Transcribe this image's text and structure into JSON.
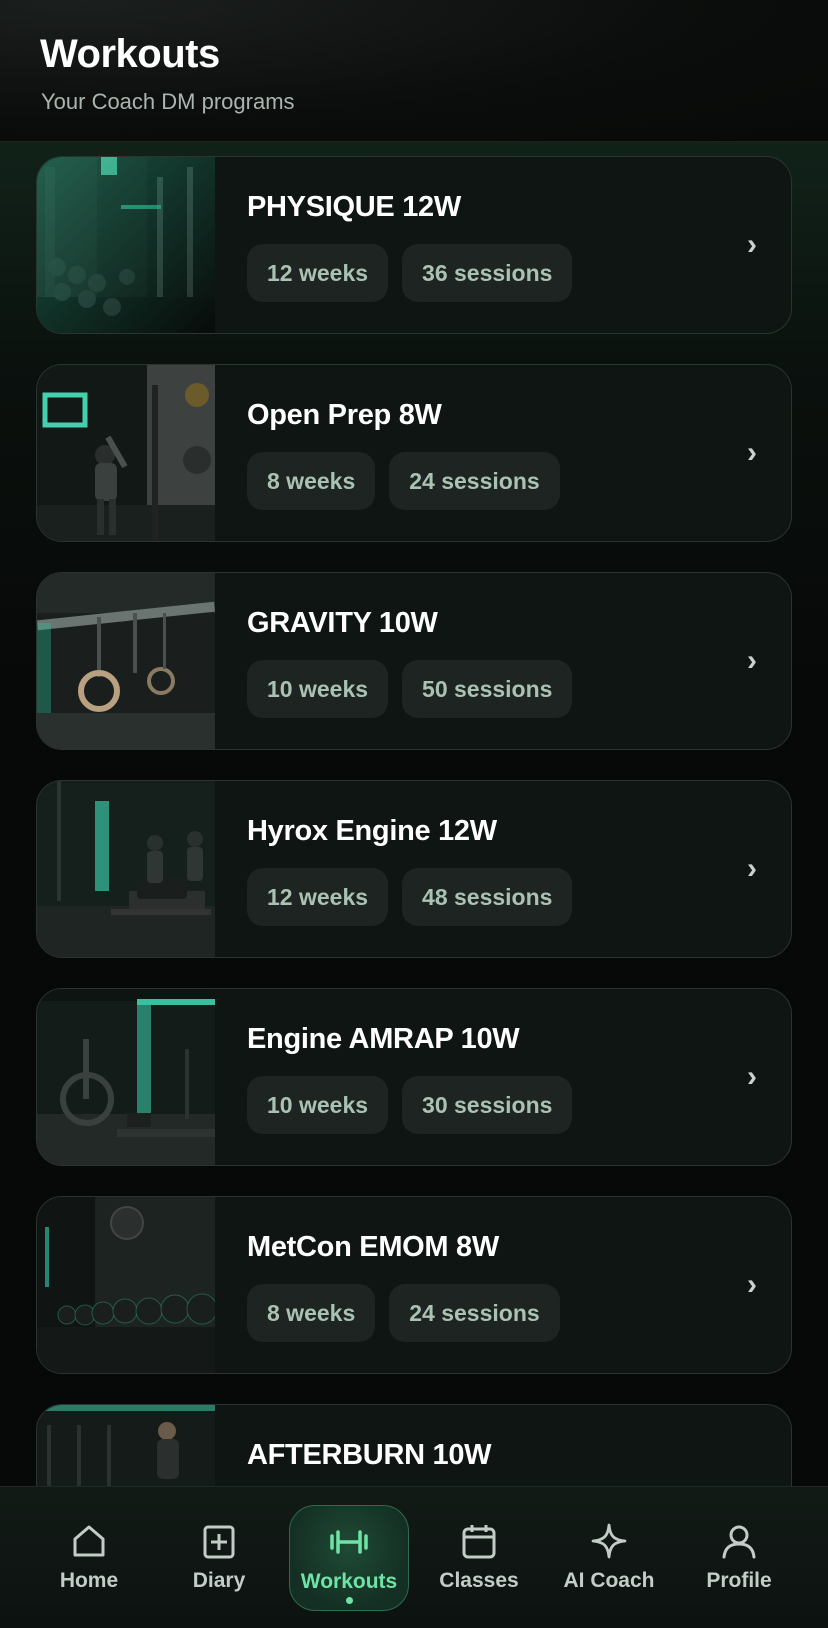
{
  "header": {
    "title": "Workouts",
    "subtitle": "Your Coach DM programs"
  },
  "programs": [
    {
      "title": "PHYSIQUE 12W",
      "weeks": "12 weeks",
      "sessions": "36 sessions",
      "image": "gym-racks-image"
    },
    {
      "title": "Open Prep 8W",
      "weeks": "8 weeks",
      "sessions": "24 sessions",
      "image": "athlete-wall-ball-image"
    },
    {
      "title": "GRAVITY 10W",
      "weeks": "10 weeks",
      "sessions": "50 sessions",
      "image": "gymnastic-rings-image"
    },
    {
      "title": "Hyrox Engine 12W",
      "weeks": "12 weeks",
      "sessions": "48 sessions",
      "image": "sled-push-image"
    },
    {
      "title": "Engine AMRAP 10W",
      "weeks": "10 weeks",
      "sessions": "30 sessions",
      "image": "air-bike-rower-image"
    },
    {
      "title": "MetCon EMOM 8W",
      "weeks": "8 weeks",
      "sessions": "24 sessions",
      "image": "kettlebells-clock-image"
    },
    {
      "title": "AFTERBURN 10W",
      "weeks": "",
      "sessions": "",
      "image": "athlete-training-image"
    }
  ],
  "chevron": "›",
  "nav": {
    "items": [
      {
        "label": "Home",
        "icon": "home-icon"
      },
      {
        "label": "Diary",
        "icon": "diary-plus-icon"
      },
      {
        "label": "Workouts",
        "icon": "dumbbell-icon",
        "active": true
      },
      {
        "label": "Classes",
        "icon": "calendar-icon"
      },
      {
        "label": "AI Coach",
        "icon": "sparkle-icon"
      },
      {
        "label": "Profile",
        "icon": "user-icon"
      }
    ]
  },
  "colors": {
    "accent": "#6fe3a6",
    "background": "#070908",
    "card": "#0f1513",
    "chip": "#1d2422",
    "chip_text": "#a9c2b3"
  }
}
